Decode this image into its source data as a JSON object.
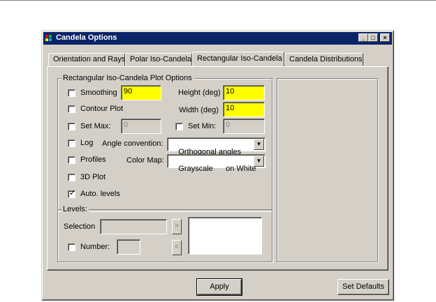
{
  "window": {
    "title": "Candela Options",
    "minimize_glyph": "_",
    "maximize_glyph": "□",
    "close_glyph": "×",
    "icon": "app-logo-icon"
  },
  "tabs": [
    {
      "label": "Orientation and Rays",
      "active": false
    },
    {
      "label": "Polar Iso-Candela",
      "active": false
    },
    {
      "label": "Rectangular Iso-Candela",
      "active": true
    },
    {
      "label": "Candela Distributions",
      "active": false
    }
  ],
  "plot_options": {
    "group_label": "Rectangular Iso-Candela Plot Options",
    "smoothing": {
      "label": "Smoothing",
      "checked": false,
      "value": "90"
    },
    "height": {
      "label": "Height (deg)",
      "value": "10"
    },
    "contour_plot": {
      "label": "Contour Plot",
      "checked": false
    },
    "width": {
      "label": "Width (deg)",
      "value": "10"
    },
    "set_max": {
      "label": "Set Max:",
      "checked": false,
      "value": "0"
    },
    "set_min": {
      "label": "Set Min:",
      "checked": false,
      "value": "0"
    },
    "log": {
      "label": "Log",
      "checked": false
    },
    "angle_convention": {
      "label": "Angle convention:",
      "value": "Orthogonal angles"
    },
    "profiles": {
      "label": "Profiles",
      "checked": false
    },
    "color_map": {
      "label": "Color Map:",
      "value": "Grayscale      on White"
    },
    "plot_3d": {
      "label": "3D Plot",
      "checked": false
    },
    "auto_levels": {
      "label": "Auto. levels",
      "checked": true
    }
  },
  "levels": {
    "group_label": "Levels:",
    "selection_label": "Selection",
    "selection_value": "",
    "add_glyph": ">",
    "remove_glyph": "<",
    "number": {
      "label": "Number:",
      "checked": false,
      "value": ""
    }
  },
  "footer": {
    "apply_label": "Apply",
    "set_defaults_label": "Set Defaults"
  },
  "colors": {
    "title_bar": "#0a246a",
    "face": "#d4d0c8",
    "highlight_field": "#ffff00"
  }
}
